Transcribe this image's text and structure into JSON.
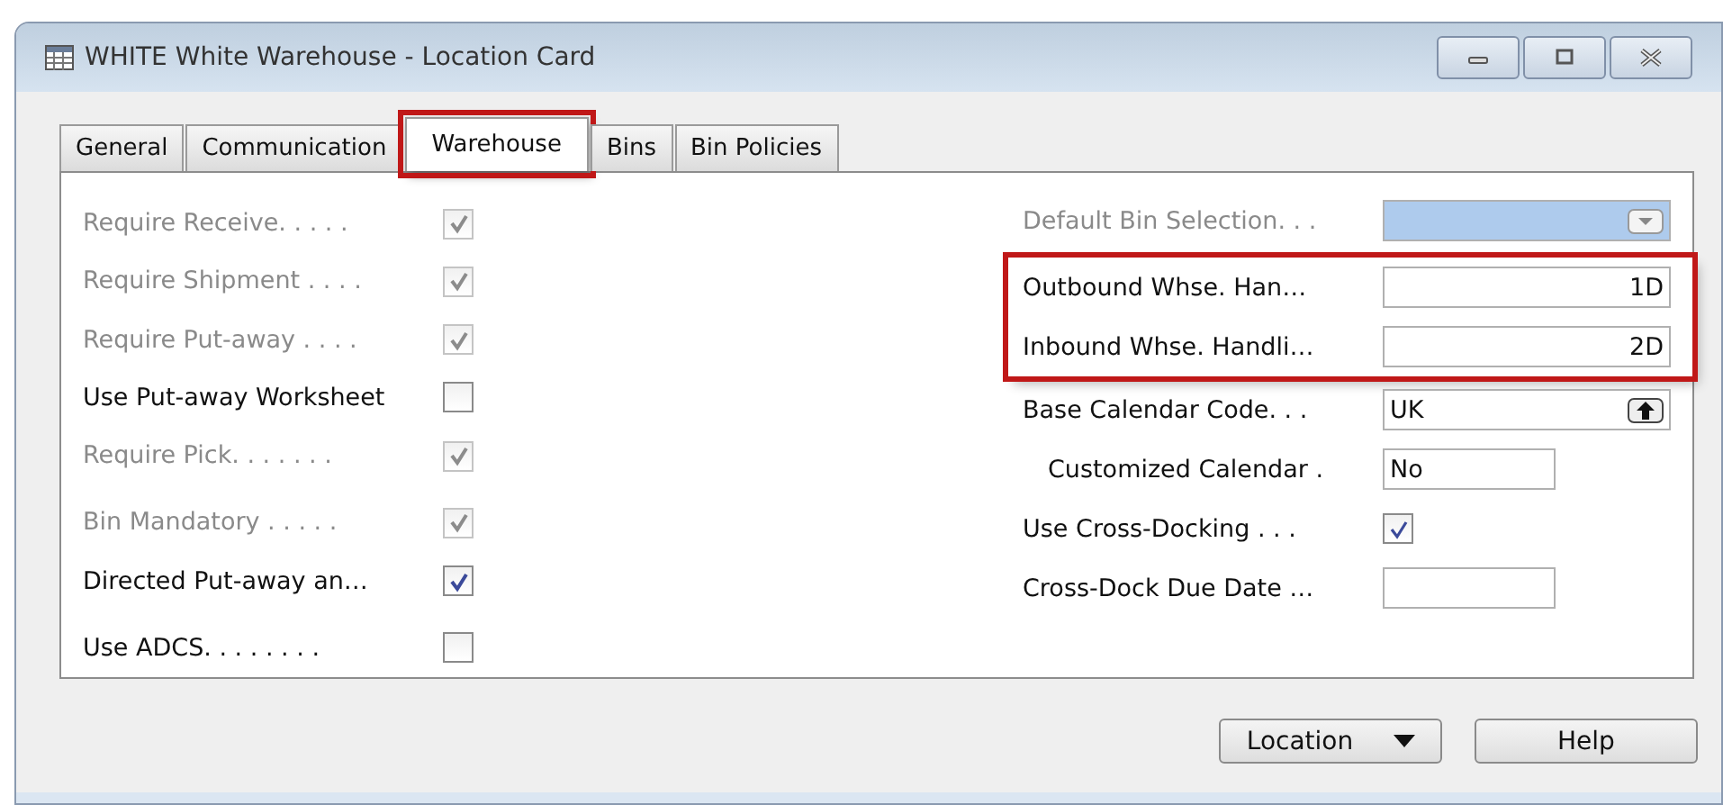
{
  "window": {
    "title": "WHITE White Warehouse - Location Card"
  },
  "tabs": [
    {
      "label": "General",
      "selected": false,
      "highlighted": false
    },
    {
      "label": "Communication",
      "selected": false,
      "highlighted": false
    },
    {
      "label": "Warehouse",
      "selected": true,
      "highlighted": true
    },
    {
      "label": "Bins",
      "selected": false,
      "highlighted": false
    },
    {
      "label": "Bin Policies",
      "selected": false,
      "highlighted": false
    }
  ],
  "left_fields": [
    {
      "label": "Require Receive. . . . .",
      "checked": true,
      "disabled": true,
      "gap": false
    },
    {
      "label": "Require Shipment . . . .",
      "checked": true,
      "disabled": true,
      "gap": false
    },
    {
      "label": "Require Put-away . . . .",
      "checked": true,
      "disabled": true,
      "gap": false
    },
    {
      "label": "Use Put-away Worksheet",
      "checked": false,
      "disabled": false,
      "gap": false
    },
    {
      "label": "Require Pick. . . . . . .",
      "checked": true,
      "disabled": true,
      "gap": false
    },
    {
      "label": "Bin Mandatory  . . . . .",
      "checked": true,
      "disabled": true,
      "gap": true
    },
    {
      "label": "Directed Put-away an…",
      "checked": true,
      "disabled": false,
      "gap": false
    },
    {
      "label": "Use ADCS. . . . . . . .",
      "checked": false,
      "disabled": false,
      "gap": true
    }
  ],
  "right_sections": [
    {
      "highlighted": false,
      "fields": [
        {
          "kind": "dropdown",
          "label": "Default Bin Selection. . .",
          "disabled": true
        }
      ]
    },
    {
      "highlighted": true,
      "fields": [
        {
          "kind": "text",
          "label": "Outbound Whse. Han…",
          "value": "1D",
          "disabled": false
        },
        {
          "kind": "text",
          "label": "Inbound Whse. Handli…",
          "value": "2D",
          "disabled": false
        }
      ]
    },
    {
      "highlighted": false,
      "fields": [
        {
          "kind": "lookup",
          "label": "Base Calendar Code. . .",
          "value": "UK",
          "disabled": false
        },
        {
          "kind": "short",
          "label": "Customized Calendar  .",
          "value": "No",
          "disabled": false,
          "indent": true
        }
      ]
    },
    {
      "highlighted": false,
      "fields": [
        {
          "kind": "checkbox",
          "label": "Use Cross-Docking  . . .",
          "checked": true,
          "disabled": false
        },
        {
          "kind": "short",
          "label": "Cross-Dock Due Date …",
          "disabled": false
        }
      ]
    }
  ],
  "buttons": [
    {
      "label": "Location",
      "menu": true
    },
    {
      "label": "Help",
      "menu": false
    }
  ]
}
